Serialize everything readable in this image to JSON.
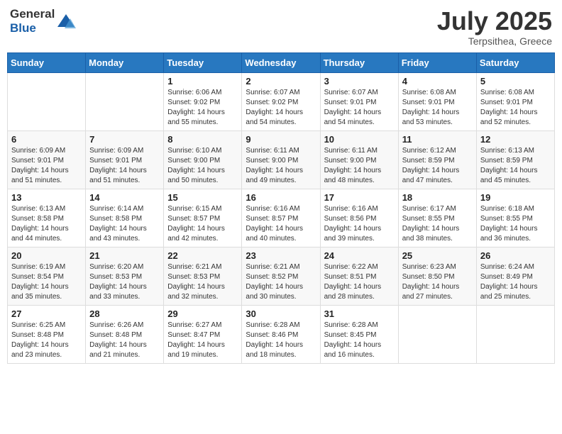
{
  "logo": {
    "general": "General",
    "blue": "Blue"
  },
  "title": {
    "month_year": "July 2025",
    "location": "Terpsithea, Greece"
  },
  "days_header": [
    "Sunday",
    "Monday",
    "Tuesday",
    "Wednesday",
    "Thursday",
    "Friday",
    "Saturday"
  ],
  "weeks": [
    [
      {
        "day": "",
        "info": ""
      },
      {
        "day": "",
        "info": ""
      },
      {
        "day": "1",
        "info": "Sunrise: 6:06 AM\nSunset: 9:02 PM\nDaylight: 14 hours and 55 minutes."
      },
      {
        "day": "2",
        "info": "Sunrise: 6:07 AM\nSunset: 9:02 PM\nDaylight: 14 hours and 54 minutes."
      },
      {
        "day": "3",
        "info": "Sunrise: 6:07 AM\nSunset: 9:01 PM\nDaylight: 14 hours and 54 minutes."
      },
      {
        "day": "4",
        "info": "Sunrise: 6:08 AM\nSunset: 9:01 PM\nDaylight: 14 hours and 53 minutes."
      },
      {
        "day": "5",
        "info": "Sunrise: 6:08 AM\nSunset: 9:01 PM\nDaylight: 14 hours and 52 minutes."
      }
    ],
    [
      {
        "day": "6",
        "info": "Sunrise: 6:09 AM\nSunset: 9:01 PM\nDaylight: 14 hours and 51 minutes."
      },
      {
        "day": "7",
        "info": "Sunrise: 6:09 AM\nSunset: 9:01 PM\nDaylight: 14 hours and 51 minutes."
      },
      {
        "day": "8",
        "info": "Sunrise: 6:10 AM\nSunset: 9:00 PM\nDaylight: 14 hours and 50 minutes."
      },
      {
        "day": "9",
        "info": "Sunrise: 6:11 AM\nSunset: 9:00 PM\nDaylight: 14 hours and 49 minutes."
      },
      {
        "day": "10",
        "info": "Sunrise: 6:11 AM\nSunset: 9:00 PM\nDaylight: 14 hours and 48 minutes."
      },
      {
        "day": "11",
        "info": "Sunrise: 6:12 AM\nSunset: 8:59 PM\nDaylight: 14 hours and 47 minutes."
      },
      {
        "day": "12",
        "info": "Sunrise: 6:13 AM\nSunset: 8:59 PM\nDaylight: 14 hours and 45 minutes."
      }
    ],
    [
      {
        "day": "13",
        "info": "Sunrise: 6:13 AM\nSunset: 8:58 PM\nDaylight: 14 hours and 44 minutes."
      },
      {
        "day": "14",
        "info": "Sunrise: 6:14 AM\nSunset: 8:58 PM\nDaylight: 14 hours and 43 minutes."
      },
      {
        "day": "15",
        "info": "Sunrise: 6:15 AM\nSunset: 8:57 PM\nDaylight: 14 hours and 42 minutes."
      },
      {
        "day": "16",
        "info": "Sunrise: 6:16 AM\nSunset: 8:57 PM\nDaylight: 14 hours and 40 minutes."
      },
      {
        "day": "17",
        "info": "Sunrise: 6:16 AM\nSunset: 8:56 PM\nDaylight: 14 hours and 39 minutes."
      },
      {
        "day": "18",
        "info": "Sunrise: 6:17 AM\nSunset: 8:55 PM\nDaylight: 14 hours and 38 minutes."
      },
      {
        "day": "19",
        "info": "Sunrise: 6:18 AM\nSunset: 8:55 PM\nDaylight: 14 hours and 36 minutes."
      }
    ],
    [
      {
        "day": "20",
        "info": "Sunrise: 6:19 AM\nSunset: 8:54 PM\nDaylight: 14 hours and 35 minutes."
      },
      {
        "day": "21",
        "info": "Sunrise: 6:20 AM\nSunset: 8:53 PM\nDaylight: 14 hours and 33 minutes."
      },
      {
        "day": "22",
        "info": "Sunrise: 6:21 AM\nSunset: 8:53 PM\nDaylight: 14 hours and 32 minutes."
      },
      {
        "day": "23",
        "info": "Sunrise: 6:21 AM\nSunset: 8:52 PM\nDaylight: 14 hours and 30 minutes."
      },
      {
        "day": "24",
        "info": "Sunrise: 6:22 AM\nSunset: 8:51 PM\nDaylight: 14 hours and 28 minutes."
      },
      {
        "day": "25",
        "info": "Sunrise: 6:23 AM\nSunset: 8:50 PM\nDaylight: 14 hours and 27 minutes."
      },
      {
        "day": "26",
        "info": "Sunrise: 6:24 AM\nSunset: 8:49 PM\nDaylight: 14 hours and 25 minutes."
      }
    ],
    [
      {
        "day": "27",
        "info": "Sunrise: 6:25 AM\nSunset: 8:48 PM\nDaylight: 14 hours and 23 minutes."
      },
      {
        "day": "28",
        "info": "Sunrise: 6:26 AM\nSunset: 8:48 PM\nDaylight: 14 hours and 21 minutes."
      },
      {
        "day": "29",
        "info": "Sunrise: 6:27 AM\nSunset: 8:47 PM\nDaylight: 14 hours and 19 minutes."
      },
      {
        "day": "30",
        "info": "Sunrise: 6:28 AM\nSunset: 8:46 PM\nDaylight: 14 hours and 18 minutes."
      },
      {
        "day": "31",
        "info": "Sunrise: 6:28 AM\nSunset: 8:45 PM\nDaylight: 14 hours and 16 minutes."
      },
      {
        "day": "",
        "info": ""
      },
      {
        "day": "",
        "info": ""
      }
    ]
  ]
}
